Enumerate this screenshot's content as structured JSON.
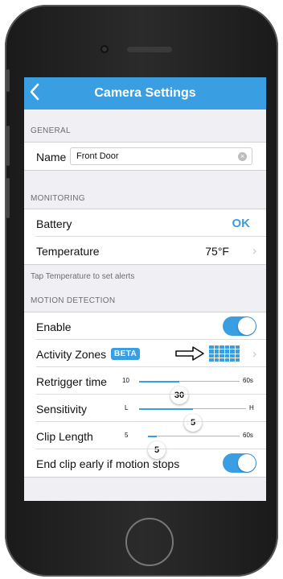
{
  "nav": {
    "back_icon": "chevron-left-icon",
    "title": "Camera Settings"
  },
  "general": {
    "header": "GENERAL",
    "name_label": "Name",
    "name_value": "Front Door",
    "clear_icon": "clear-x-icon"
  },
  "monitoring": {
    "header": "MONITORING",
    "battery_label": "Battery",
    "battery_value": "OK",
    "temperature_label": "Temperature",
    "temperature_value": "75°F",
    "hint": "Tap Temperature to set alerts"
  },
  "motion": {
    "header": "MOTION DETECTION",
    "enable_label": "Enable",
    "enable_on": true,
    "zones_label": "Activity Zones",
    "zones_badge": "BETA",
    "retrigger": {
      "label": "Retrigger time",
      "min": "10",
      "max": "60s",
      "value": "30",
      "fraction": 0.4
    },
    "sensitivity": {
      "label": "Sensitivity",
      "min": "L",
      "max": "H",
      "value": "5",
      "fraction": 0.5
    },
    "clip_length": {
      "label": "Clip Length",
      "min": "5",
      "max": "60s",
      "value": "5",
      "fraction": 0.0
    },
    "end_clip_label": "End clip early if motion stops",
    "end_clip_on": true
  },
  "colors": {
    "accent": "#3a9ee3",
    "background": "#efeff4"
  }
}
